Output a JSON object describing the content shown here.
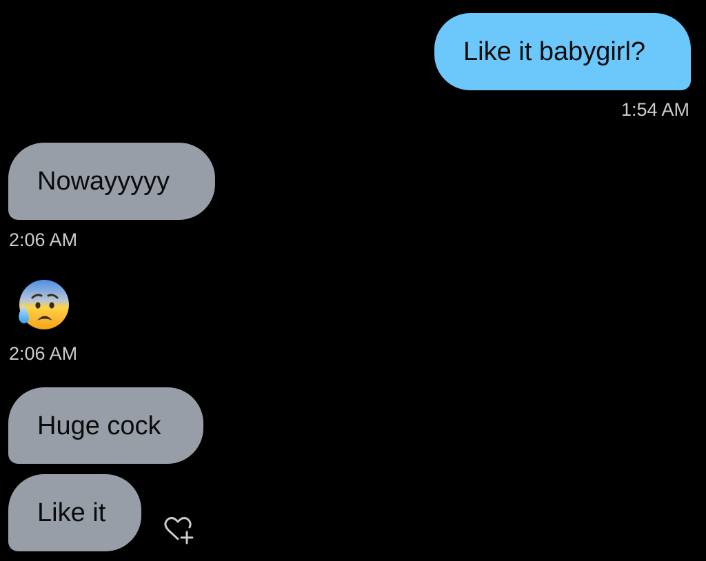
{
  "conversation": {
    "messages": [
      {
        "direction": "sent",
        "text": "Like it babygirl?",
        "time": "1:54 AM"
      },
      {
        "direction": "received",
        "text": "Nowayyyyy",
        "time": "2:06 AM"
      },
      {
        "direction": "received",
        "emoji": "anxious-face-with-sweat",
        "time": "2:06 AM"
      },
      {
        "direction": "received",
        "text": "Huge cock"
      },
      {
        "direction": "received",
        "text": "Like it"
      }
    ],
    "reaction_icon": "heart-plus-icon"
  },
  "colors": {
    "background": "#000000",
    "sent_bubble": "#6cc8fb",
    "received_bubble": "#979ea8",
    "timestamp": "#c9ccd1"
  }
}
